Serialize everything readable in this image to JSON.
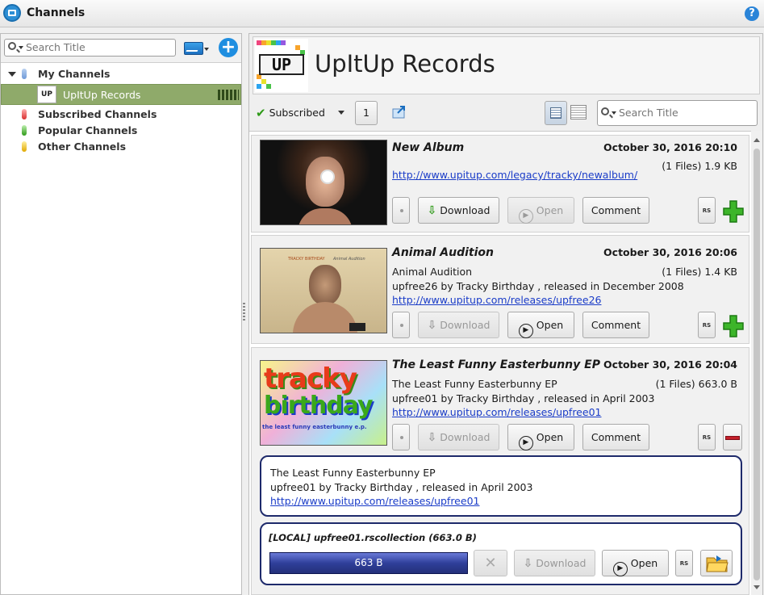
{
  "window": {
    "title": "Channels",
    "help": "?"
  },
  "sidebar": {
    "search_placeholder": "Search Title",
    "tree": {
      "my_channels": "My Channels",
      "selected_channel": "UpItUp Records",
      "subscribed": "Subscribed Channels",
      "popular": "Popular Channels",
      "other": "Other Channels"
    }
  },
  "channel": {
    "logo_text": "UP",
    "name": "UpItUp Records",
    "subscribed_label": "Subscribed",
    "count": "1",
    "search_placeholder": "Search Title"
  },
  "buttons": {
    "download": "Download",
    "open": "Open",
    "comment": "Comment",
    "rs": "RS"
  },
  "posts": [
    {
      "title": "New Album",
      "date": "October 30, 2016 20:10",
      "files": "(1 Files) 1.9 KB",
      "link": "http://www.upitup.com/legacy/tracky/newalbum/"
    },
    {
      "title": "Animal Audition",
      "date": "October 30, 2016 20:06",
      "files": "(1 Files) 1.4 KB",
      "line1": "Animal Audition",
      "line2": "upfree26 by Tracky Birthday , released in December 2008",
      "link": "http://www.upitup.com/releases/upfree26",
      "cover_band": "TRACKY BIRTHDAY",
      "cover_album": "Animal Audition"
    },
    {
      "title": "The Least Funny Easterbunny EP",
      "date": "October 30, 2016 20:04",
      "files": "(1 Files) 663.0 B",
      "line1": "The Least Funny Easterbunny EP",
      "line2": "upfree01 by Tracky Birthday , released in April 2003",
      "link": "http://www.upitup.com/releases/upfree01",
      "cover_line1": "tracky",
      "cover_line2": "birthday",
      "cover_line3": "the least funny easterbunny e.p.",
      "expanded_line1": "The Least Funny Easterbunny EP",
      "expanded_line2": "upfree01 by Tracky Birthday , released in April 2003",
      "expanded_link": "http://www.upitup.com/releases/upfree01",
      "file_title": "[LOCAL] upfree01.rscollection (663.0 B)",
      "file_progress_label": "663 B",
      "file_progress": 1.0
    }
  ],
  "colors": {
    "accent_green": "#2e9a18",
    "link": "#1a3cc8",
    "selected_tree": "#8faa6a",
    "progress": "#2f3f9a",
    "remove_red": "#c4202a"
  }
}
